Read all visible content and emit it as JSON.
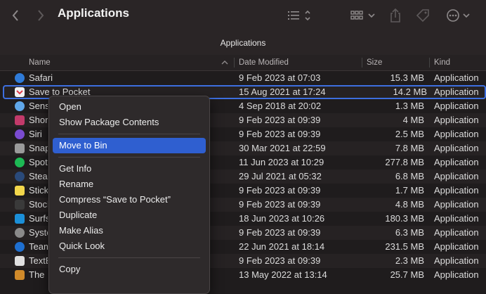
{
  "window": {
    "title": "Applications",
    "path_title": "Applications"
  },
  "toolbar": {
    "back_icon": "chevron-left-icon",
    "forward_icon": "chevron-right-icon",
    "list_view_icon": "list-icon",
    "grid_view_icon": "grid-icon",
    "share_icon": "share-icon",
    "tag_icon": "tag-icon",
    "more_icon": "ellipsis-icon"
  },
  "columns": {
    "name": "Name",
    "date": "Date Modified",
    "size": "Size",
    "kind": "Kind"
  },
  "rows": [
    {
      "name": "Safari",
      "date": "9 Feb 2023 at 07:03",
      "size": "15.3 MB",
      "kind": "Application",
      "icon_color": "#2f7bd8"
    },
    {
      "name": "Save to Pocket",
      "date": "15 Aug 2021 at 17:24",
      "size": "14.2 MB",
      "kind": "Application",
      "icon_color": "#e8e8e8"
    },
    {
      "name": "Sense",
      "date": "4 Sep 2018 at 20:02",
      "size": "1.3 MB",
      "kind": "Application",
      "icon_color": "#5fa6e8"
    },
    {
      "name": "Shortcuts",
      "date": "9 Feb 2023 at 09:39",
      "size": "4 MB",
      "kind": "Application",
      "icon_color": "#c23a6a"
    },
    {
      "name": "Siri",
      "date": "9 Feb 2023 at 09:39",
      "size": "2.5 MB",
      "kind": "Application",
      "icon_color": "#7a4bd0"
    },
    {
      "name": "Snap",
      "date": "30 Mar 2021 at 22:59",
      "size": "7.8 MB",
      "kind": "Application",
      "icon_color": "#9a9a9a"
    },
    {
      "name": "Spotify",
      "date": "11 Jun 2023 at 10:29",
      "size": "277.8 MB",
      "kind": "Application",
      "icon_color": "#1db954"
    },
    {
      "name": "Steam",
      "date": "29 Jul 2021 at 05:32",
      "size": "6.8 MB",
      "kind": "Application",
      "icon_color": "#2a4a7a"
    },
    {
      "name": "Stickies",
      "date": "9 Feb 2023 at 09:39",
      "size": "1.7 MB",
      "kind": "Application",
      "icon_color": "#f2d64b"
    },
    {
      "name": "Stocks",
      "date": "9 Feb 2023 at 09:39",
      "size": "4.8 MB",
      "kind": "Application",
      "icon_color": "#3a3a3a"
    },
    {
      "name": "Surfshark",
      "date": "18 Jun 2023 at 10:26",
      "size": "180.3 MB",
      "kind": "Application",
      "icon_color": "#1b8fd8"
    },
    {
      "name": "System Settings",
      "date": "9 Feb 2023 at 09:39",
      "size": "6.3 MB",
      "kind": "Application",
      "icon_color": "#8a8a8a"
    },
    {
      "name": "TeamViewer",
      "date": "22 Jun 2021 at 18:14",
      "size": "231.5 MB",
      "kind": "Application",
      "icon_color": "#1e6fd0"
    },
    {
      "name": "TextEdit",
      "date": "9 Feb 2023 at 09:39",
      "size": "2.3 MB",
      "kind": "Application",
      "icon_color": "#e0e0e0"
    },
    {
      "name": "The Unarchiver",
      "date": "13 May 2022 at 13:14",
      "size": "25.7 MB",
      "kind": "Application",
      "icon_color": "#d08a2a"
    }
  ],
  "context_menu": {
    "items": [
      {
        "label": "Open"
      },
      {
        "label": "Show Package Contents"
      },
      {
        "label": "Move to Bin"
      },
      {
        "label": "Get Info"
      },
      {
        "label": "Rename"
      },
      {
        "label": "Compress “Save to Pocket”"
      },
      {
        "label": "Duplicate"
      },
      {
        "label": "Make Alias"
      },
      {
        "label": "Quick Look"
      },
      {
        "label": "Copy"
      }
    ]
  },
  "colors": {
    "selection": "#3d6fe0",
    "highlight": "#2f5fd0"
  }
}
